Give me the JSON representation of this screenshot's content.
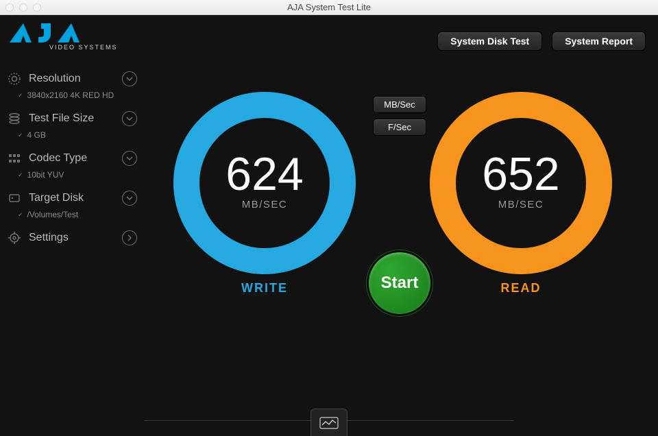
{
  "window": {
    "title": "AJA System Test Lite"
  },
  "logo": {
    "brand": "AJA",
    "sub": "VIDEO SYSTEMS"
  },
  "topButtons": {
    "diskTest": "System Disk Test",
    "report": "System Report"
  },
  "sidebar": {
    "resolution": {
      "label": "Resolution",
      "value": "3840x2160 4K RED HD"
    },
    "testFileSize": {
      "label": "Test File Size",
      "value": "4 GB"
    },
    "codecType": {
      "label": "Codec Type",
      "value": "10bit YUV"
    },
    "targetDisk": {
      "label": "Target Disk",
      "value": "/Volumes/Test"
    },
    "settings": {
      "label": "Settings"
    }
  },
  "units": {
    "mbsec": "MB/Sec",
    "fsec": "F/Sec"
  },
  "gauges": {
    "write": {
      "value": "624",
      "unit": "MB/SEC",
      "label": "WRITE"
    },
    "read": {
      "value": "652",
      "unit": "MB/SEC",
      "label": "READ"
    }
  },
  "start": {
    "label": "Start"
  },
  "colors": {
    "write": "#26a9e0",
    "read": "#f7941e",
    "start": "#1a7a1a"
  }
}
